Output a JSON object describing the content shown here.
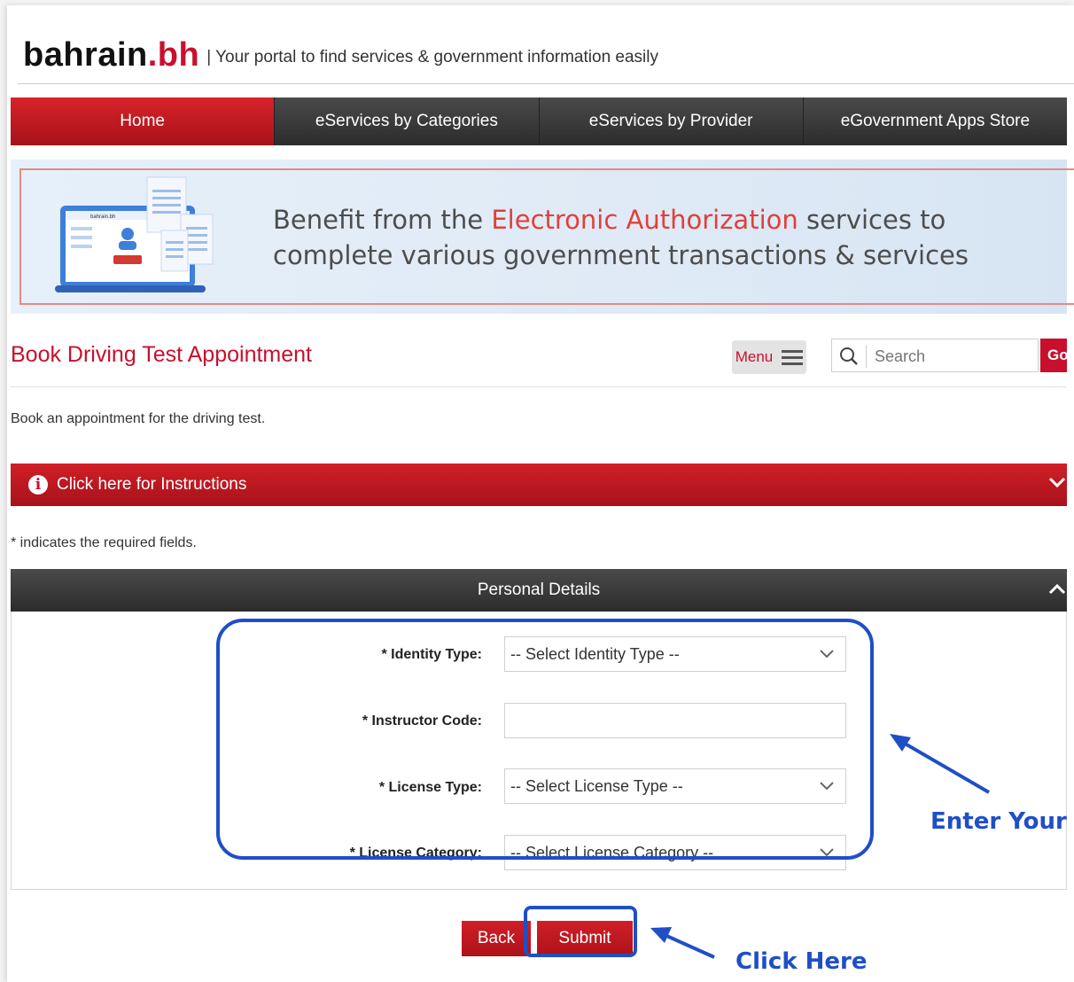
{
  "header": {
    "logo_main": "bahrain",
    "logo_suffix": ".bh",
    "tagline": "| Your portal to find services & government information easily"
  },
  "nav": {
    "items": [
      {
        "label": "Home",
        "active": true
      },
      {
        "label": "eServices by Categories",
        "active": false
      },
      {
        "label": "eServices by Provider",
        "active": false
      },
      {
        "label": "eGovernment Apps Store",
        "active": false
      }
    ]
  },
  "banner": {
    "line1_before": "Benefit from the ",
    "line1_highlight": "Electronic Authorization",
    "line1_after": " services to",
    "line2": "complete various government transactions & services",
    "illustration_text": "bahrain.bh"
  },
  "page": {
    "title": "Book Driving Test Appointment",
    "menu_label": "Menu",
    "search_placeholder": "Search",
    "go_label": "Go",
    "description": "Book an appointment for the driving test.",
    "instructions_label": "Click here for Instructions",
    "required_note": "* indicates the required fields."
  },
  "form": {
    "section_title": "Personal Details",
    "identity_type_label": "* Identity Type:",
    "identity_type_value": "-- Select Identity Type --",
    "instructor_code_label": "* Instructor Code:",
    "instructor_code_value": "",
    "license_type_label": "* License Type:",
    "license_type_value": "-- Select License Type --",
    "license_category_label": "* License Category:",
    "license_category_value": "-- Select License Category --"
  },
  "buttons": {
    "back": "Back",
    "submit": "Submit"
  },
  "annotations": {
    "enter_text": "Enter Your",
    "click_text": "Click Here"
  },
  "colors": {
    "brand_red": "#c8102e",
    "annotation_blue": "#1f4fc7",
    "nav_dark": "#3a3a3a"
  }
}
